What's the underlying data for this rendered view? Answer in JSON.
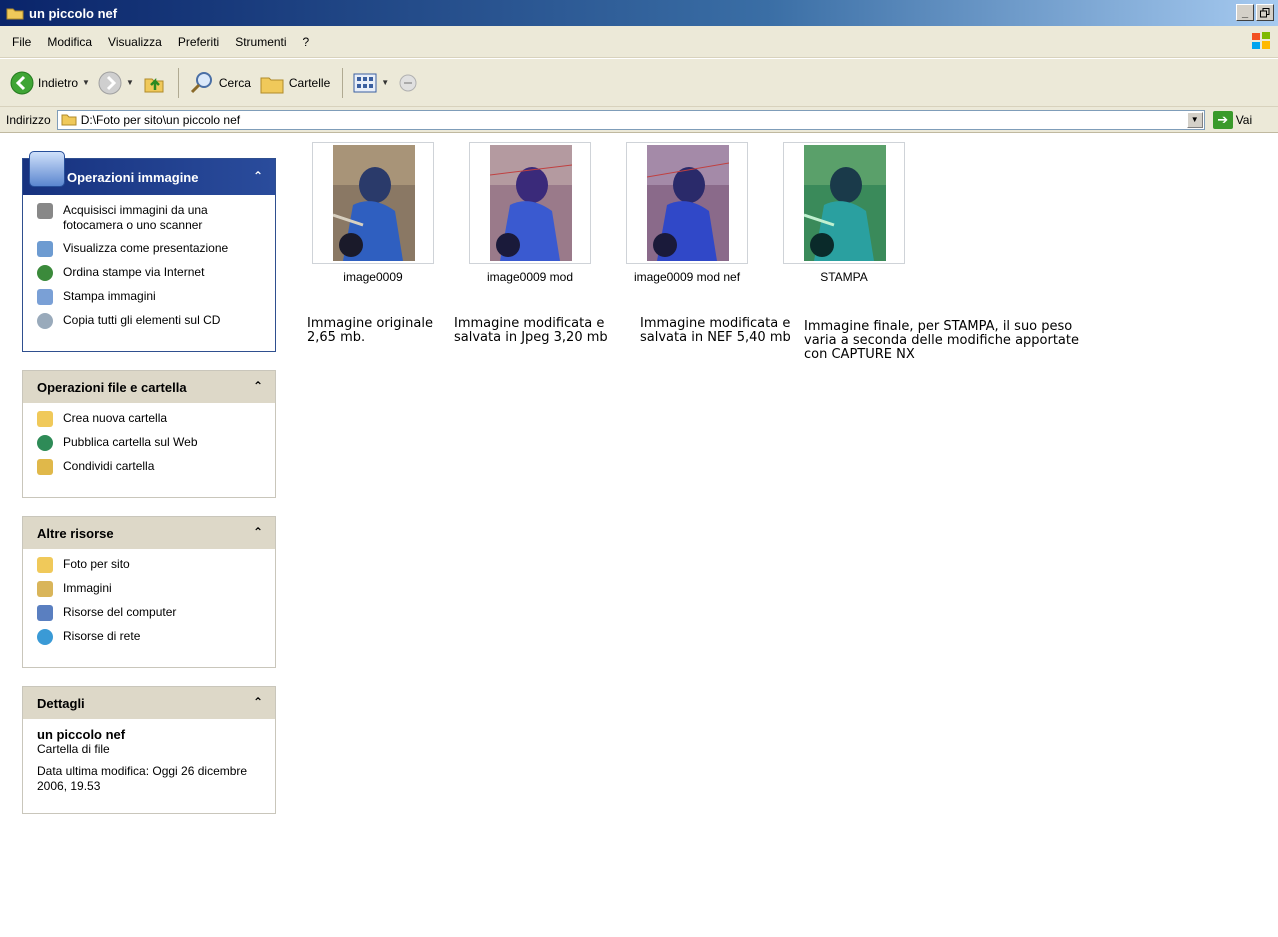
{
  "window": {
    "title": "un piccolo nef",
    "buttons": [
      "_",
      "ₔ"
    ]
  },
  "menu": [
    "File",
    "Modifica",
    "Visualizza",
    "Preferiti",
    "Strumenti",
    "?"
  ],
  "toolbar": {
    "back": "Indietro",
    "search": "Cerca",
    "folders": "Cartelle"
  },
  "address": {
    "label": "Indirizzo",
    "path": "D:\\Foto per sito\\un piccolo nef",
    "go": "Vai"
  },
  "panels": {
    "image_ops": {
      "title": "Operazioni immagine",
      "items": [
        "Acquisisci immagini da una fotocamera o uno scanner",
        "Visualizza come presentazione",
        "Ordina stampe via Internet",
        "Stampa immagini",
        "Copia tutti gli elementi sul CD"
      ]
    },
    "file_ops": {
      "title": "Operazioni file e cartella",
      "items": [
        "Crea nuova cartella",
        "Pubblica cartella sul Web",
        "Condividi cartella"
      ]
    },
    "other": {
      "title": "Altre risorse",
      "items": [
        "Foto per sito",
        "Immagini",
        "Risorse del computer",
        "Risorse di rete"
      ]
    },
    "details": {
      "title": "Dettagli",
      "name": "un piccolo nef",
      "type": "Cartella di file",
      "modified": "Data ultima modifica: Oggi 26 dicembre 2006, 19.53"
    }
  },
  "files": [
    {
      "name": "image0009",
      "description": "Immagine originale 2,65 mb."
    },
    {
      "name": "image0009 mod",
      "description": "Immagine modificata e salvata in Jpeg 3,20 mb"
    },
    {
      "name": "image0009 mod nef",
      "description": "Immagine modificata e salvata in NEF 5,40 mb"
    },
    {
      "name": "STAMPA",
      "description": "Immagine finale, per STAMPA, il suo peso varia a seconda delle modifiche apportate con CAPTURE NX"
    }
  ]
}
